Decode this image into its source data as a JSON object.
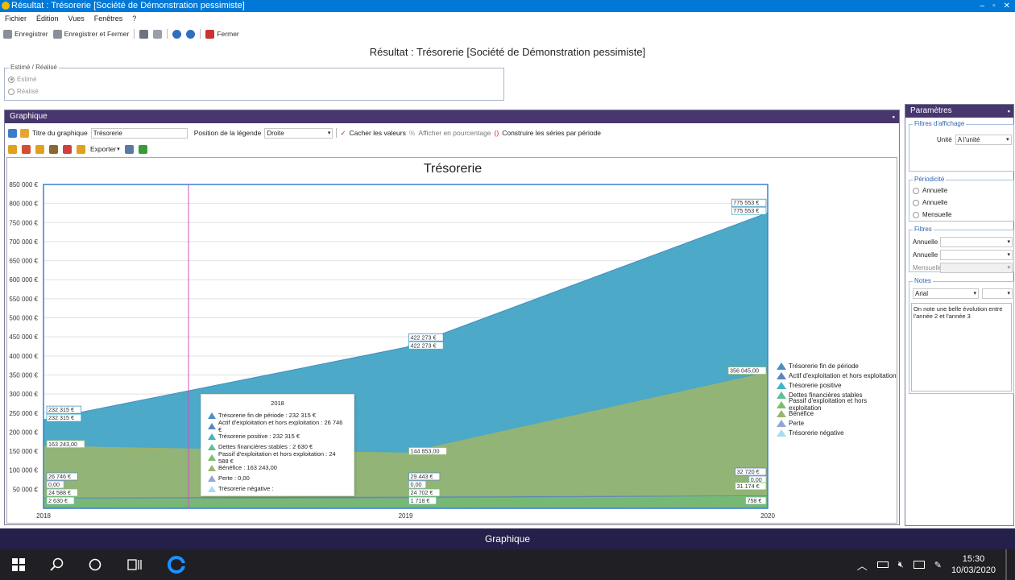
{
  "window": {
    "title": "Résultat : Trésorerie [Société de Démonstration pessimiste]"
  },
  "menu": [
    "Fichier",
    "Édition",
    "Vues",
    "Fenêtres",
    "?"
  ],
  "toolbar": {
    "save": "Enregistrer",
    "save_close": "Enregistrer et Fermer",
    "close": "Fermer"
  },
  "page_title": "Résultat : Trésorerie [Société de Démonstration pessimiste]",
  "estime_group": {
    "legend": "Estimé / Réalisé",
    "options": [
      "Estimé",
      "Réalisé"
    ],
    "selected": "Estimé"
  },
  "graph_panel": {
    "header": "Graphique",
    "title_label": "Titre du graphique",
    "title_value": "Trésorerie",
    "legend_pos_label": "Position de la légende",
    "legend_pos_value": "Droite",
    "hide_values": "Cacher les valeurs",
    "show_percent": "Afficher en pourcentage",
    "build_series": "Construire les séries par période",
    "export": "Exporter"
  },
  "chart_data": {
    "type": "area",
    "title": "Trésorerie",
    "x": [
      "2018",
      "2019",
      "2020"
    ],
    "ylim": [
      0,
      850000
    ],
    "yticks": [
      "850 000 €",
      "800 000 €",
      "750 000 €",
      "700 000 €",
      "650 000 €",
      "600 000 €",
      "550 000 €",
      "500 000 €",
      "450 000 €",
      "400 000 €",
      "350 000 €",
      "300 000 €",
      "250 000 €",
      "200 000 €",
      "150 000 €",
      "100 000 €",
      "50 000 €"
    ],
    "grid": true,
    "legend_position": "right",
    "series": [
      {
        "name": "Trésorerie fin de période",
        "values": [
          232315,
          422273,
          775553
        ],
        "labels": [
          "232 315 €",
          "422 273 €",
          "775 553 €"
        ],
        "color": "#4a90c4"
      },
      {
        "name": "Actif d'exploitation et hors exploitation",
        "values": [
          26746,
          29443,
          32720
        ],
        "labels": [
          "26 746 €",
          "29 443 €",
          "32 720 €"
        ],
        "color": "#5b87c0"
      },
      {
        "name": "Trésorerie positive",
        "values": [
          232315,
          422273,
          775553
        ],
        "labels": [
          "232 315 €",
          "422 273 €",
          "775 553 €"
        ],
        "color": "#43b3c7"
      },
      {
        "name": "Dettes financières stables",
        "values": [
          2630,
          1718,
          758
        ],
        "labels": [
          "2 630 €",
          "1 718 €",
          "758 €"
        ],
        "color": "#5fbf9a"
      },
      {
        "name": "Passif d'exploitation et hors exploitation",
        "values": [
          24588,
          24702,
          31174
        ],
        "labels": [
          "24 588 €",
          "24 702 €",
          "31 174 €"
        ],
        "color": "#7bbf6a"
      },
      {
        "name": "Bénéfice",
        "values": [
          163243,
          144853,
          356045
        ],
        "labels": [
          "163 243,00",
          "144 853,00",
          "356 045,00"
        ],
        "color": "#9ab56e"
      },
      {
        "name": "Perte",
        "values": [
          0,
          0,
          0
        ],
        "labels": [
          "0,00",
          "0,00",
          "0,00"
        ],
        "color": "#8fa8d8"
      },
      {
        "name": "Trésorerie négative",
        "values": [
          0,
          0,
          0
        ],
        "labels": [],
        "color": "#a8dcef"
      }
    ],
    "tooltip": {
      "title": "2018",
      "rows": [
        "Trésorerie fin de période : 232 315 €",
        "Actif d'exploitation et hors exploitation : 26 746 €",
        "Trésorerie positive : 232 315 €",
        "Dettes financières stables : 2 630 €",
        "Passif d'exploitation et hors exploitation : 24 588 €",
        "Bénéfice : 163 243,00",
        "Perte : 0,00",
        "Trésorerie négative :"
      ]
    }
  },
  "params": {
    "header": "Paramètres",
    "affichage": {
      "legend": "Filtres d'affichage",
      "unit_label": "Unité",
      "unit_value": "A l'unité"
    },
    "periodicite": {
      "legend": "Périodicité",
      "options": [
        "Annuelle",
        "Annuelle",
        "Mensuelle"
      ]
    },
    "filtres": {
      "legend": "Filtres",
      "rows": [
        "Annuelle",
        "Annuelle",
        "Mensuelle"
      ]
    },
    "notes": {
      "legend": "Notes",
      "font": "Arial",
      "text": "On note une belle évolution entre l'année 2 et l'année 3"
    }
  },
  "footer": "Graphique",
  "taskbar": {
    "time": "15:30",
    "date": "10/03/2020"
  }
}
